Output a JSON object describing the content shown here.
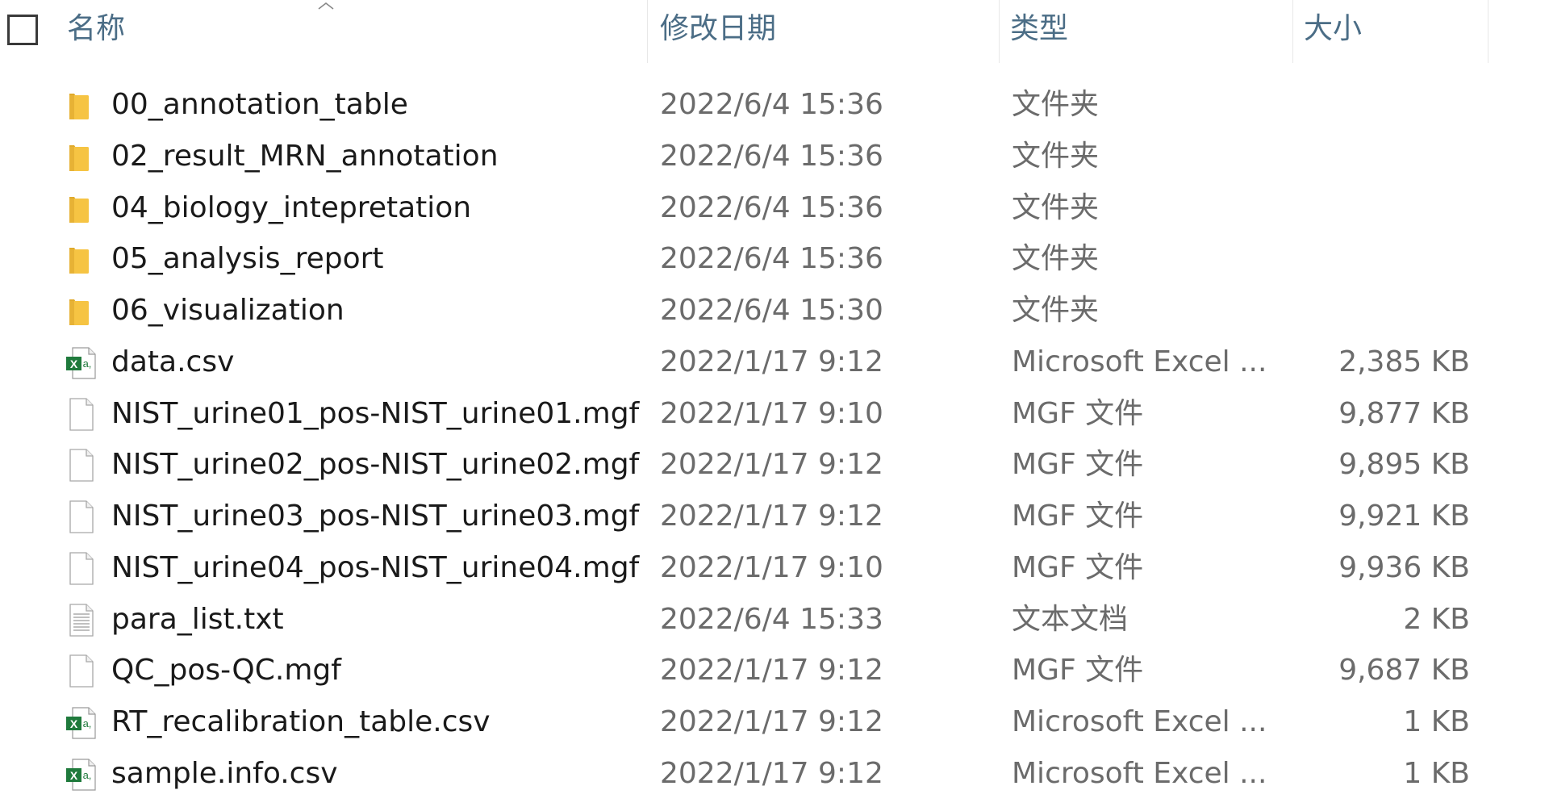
{
  "columns": {
    "name": "名称",
    "date": "修改日期",
    "type": "类型",
    "size": "大小"
  },
  "files": [
    {
      "name": "00_annotation_table",
      "date": "2022/6/4 15:36",
      "type": "文件夹",
      "size": "",
      "icon": "folder-icon"
    },
    {
      "name": "02_result_MRN_annotation",
      "date": "2022/6/4 15:36",
      "type": "文件夹",
      "size": "",
      "icon": "folder-icon"
    },
    {
      "name": "04_biology_intepretation",
      "date": "2022/6/4 15:36",
      "type": "文件夹",
      "size": "",
      "icon": "folder-icon"
    },
    {
      "name": "05_analysis_report",
      "date": "2022/6/4 15:36",
      "type": "文件夹",
      "size": "",
      "icon": "folder-icon"
    },
    {
      "name": "06_visualization",
      "date": "2022/6/4 15:30",
      "type": "文件夹",
      "size": "",
      "icon": "folder-icon"
    },
    {
      "name": "data.csv",
      "date": "2022/1/17 9:12",
      "type": "Microsoft Excel ...",
      "size": "2,385 KB",
      "icon": "excel-csv-icon"
    },
    {
      "name": "NIST_urine01_pos-NIST_urine01.mgf",
      "date": "2022/1/17 9:10",
      "type": "MGF 文件",
      "size": "9,877 KB",
      "icon": "blank-file-icon"
    },
    {
      "name": "NIST_urine02_pos-NIST_urine02.mgf",
      "date": "2022/1/17 9:12",
      "type": "MGF 文件",
      "size": "9,895 KB",
      "icon": "blank-file-icon"
    },
    {
      "name": "NIST_urine03_pos-NIST_urine03.mgf",
      "date": "2022/1/17 9:12",
      "type": "MGF 文件",
      "size": "9,921 KB",
      "icon": "blank-file-icon"
    },
    {
      "name": "NIST_urine04_pos-NIST_urine04.mgf",
      "date": "2022/1/17 9:10",
      "type": "MGF 文件",
      "size": "9,936 KB",
      "icon": "blank-file-icon"
    },
    {
      "name": "para_list.txt",
      "date": "2022/6/4 15:33",
      "type": "文本文档",
      "size": "2 KB",
      "icon": "text-file-icon"
    },
    {
      "name": "QC_pos-QC.mgf",
      "date": "2022/1/17 9:12",
      "type": "MGF 文件",
      "size": "9,687 KB",
      "icon": "blank-file-icon"
    },
    {
      "name": "RT_recalibration_table.csv",
      "date": "2022/1/17 9:12",
      "type": "Microsoft Excel ...",
      "size": "1 KB",
      "icon": "excel-csv-icon"
    },
    {
      "name": "sample.info.csv",
      "date": "2022/1/17 9:12",
      "type": "Microsoft Excel ...",
      "size": "1 KB",
      "icon": "excel-csv-icon"
    }
  ],
  "colors": {
    "header_text": "#4b6d86",
    "name_text": "#1a1a1a",
    "meta_text": "#6b6b6b",
    "folder": "#f6c443",
    "excel": "#1f7a3c"
  }
}
